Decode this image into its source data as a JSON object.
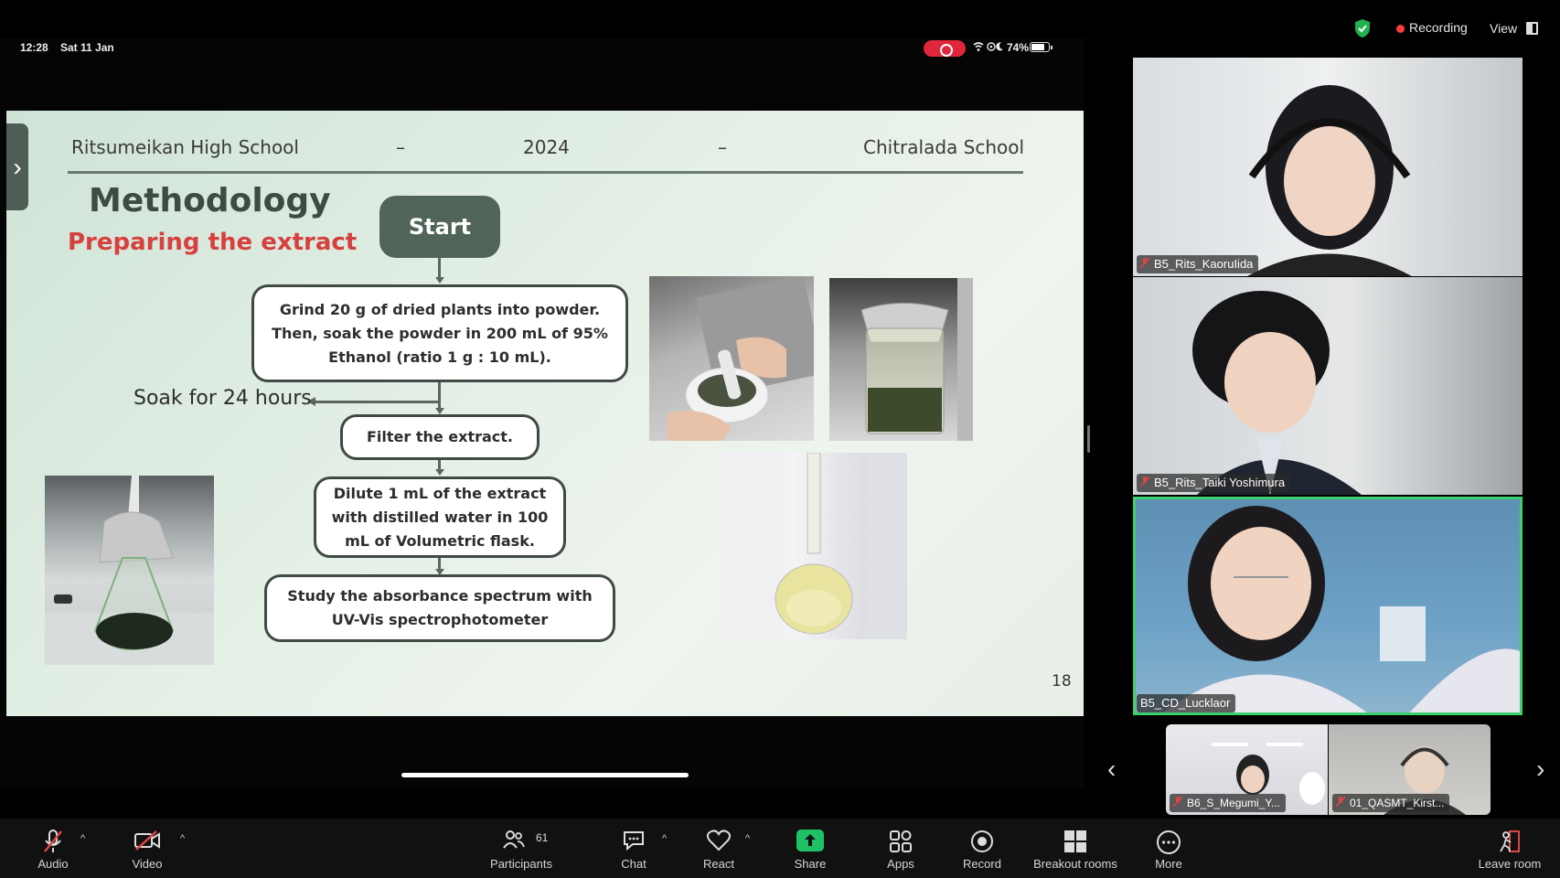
{
  "meeting": {
    "recording_label": "Recording",
    "view_label": "View"
  },
  "ipad_status": {
    "time": "12:28",
    "date": "Sat 11 Jan",
    "battery": "74%"
  },
  "slide": {
    "header_left": "Ritsumeikan High School",
    "header_dash1": "–",
    "header_year": "2024",
    "header_dash2": "–",
    "header_right": "Chitralada School",
    "title": "Methodology",
    "subtitle": "Preparing the extract",
    "start": "Start",
    "step1": "Grind 20 g of dried plants into powder. Then, soak the powder in 200 mL of 95% Ethanol (ratio 1 g : 10 mL).",
    "soak": "Soak for 24 hours",
    "step2": "Filter the extract.",
    "step3": "Dilute 1 mL of the extract with distilled water in 100 mL of Volumetric flask.",
    "step4": "Study the absorbance spectrum with UV-Vis spectrophotometer",
    "page_number": "18"
  },
  "participants_video": [
    {
      "name": "B5_Rits_KaoruIida",
      "muted": true
    },
    {
      "name": "B5_Rits_Taiki Yoshimura",
      "muted": true
    },
    {
      "name": "B5_CD_Lucklaor",
      "muted": false,
      "active_speaker": true
    }
  ],
  "thumbnails": [
    {
      "name": "B6_S_Megumi_Y...",
      "muted": true
    },
    {
      "name": "01_QASMT_Kirst...",
      "muted": true
    }
  ],
  "toolbar": {
    "audio": "Audio",
    "video": "Video",
    "participants": "Participants",
    "participants_count": "61",
    "chat": "Chat",
    "react": "React",
    "share": "Share",
    "apps": "Apps",
    "record": "Record",
    "breakout": "Breakout rooms",
    "more": "More",
    "leave": "Leave room"
  },
  "colors": {
    "accent_green": "#3ccf6e",
    "share_green": "#1ec264",
    "subtitle_red": "#d6403f",
    "recording_red": "#ff3b3b"
  }
}
